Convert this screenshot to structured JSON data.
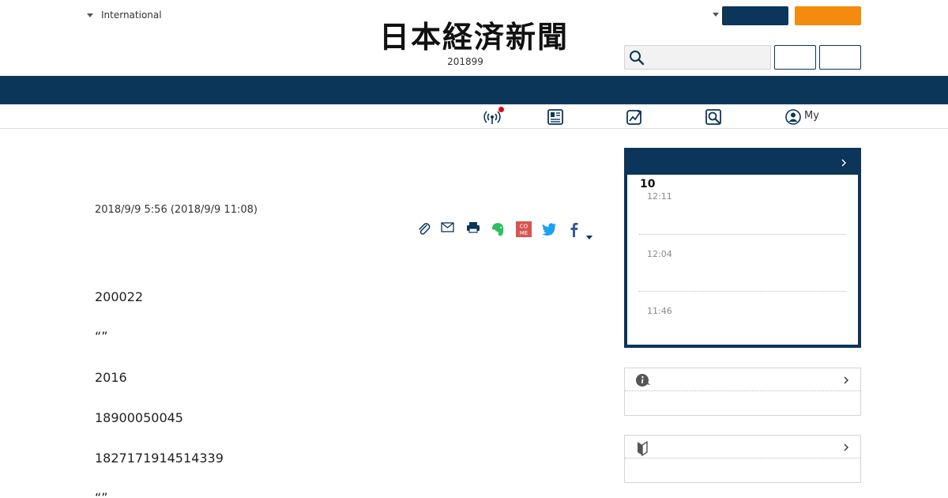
{
  "header": {
    "edition_label": "International",
    "logo_text": "日本経済新聞",
    "date_text": "201899",
    "search": {
      "placeholder": ""
    }
  },
  "iconbar": {
    "my_label": "My",
    "icons": [
      "live-broadcast-icon",
      "paper-edition-icon",
      "market-chart-icon",
      "search-icon",
      "user-icon"
    ]
  },
  "article": {
    "timestamp": "2018/9/9 5:56 (2018/9/9 11:08)",
    "paragraphs": [
      "200022",
      "“”",
      "2016",
      "18900050045",
      "1827171914514339",
      "“”"
    ],
    "share_icons": [
      "clip-icon",
      "mail-icon",
      "print-icon",
      "evernote-icon",
      "come-icon",
      "twitter-icon",
      "facebook-icon",
      "more-caret-icon"
    ],
    "come_label": "CO\nME"
  },
  "sidebar": {
    "latest": {
      "count": "10",
      "items": [
        {
          "time": "12:11"
        },
        {
          "time": "12:04"
        },
        {
          "time": "11:46"
        }
      ]
    }
  },
  "colors": {
    "navy": "#0b3559",
    "orange": "#f48b0e",
    "live_red": "#e0001b",
    "evernote_green": "#2dbe60",
    "twitter_blue": "#1da1f2",
    "facebook_navy": "#3b5998",
    "come_red": "#d9534f"
  }
}
